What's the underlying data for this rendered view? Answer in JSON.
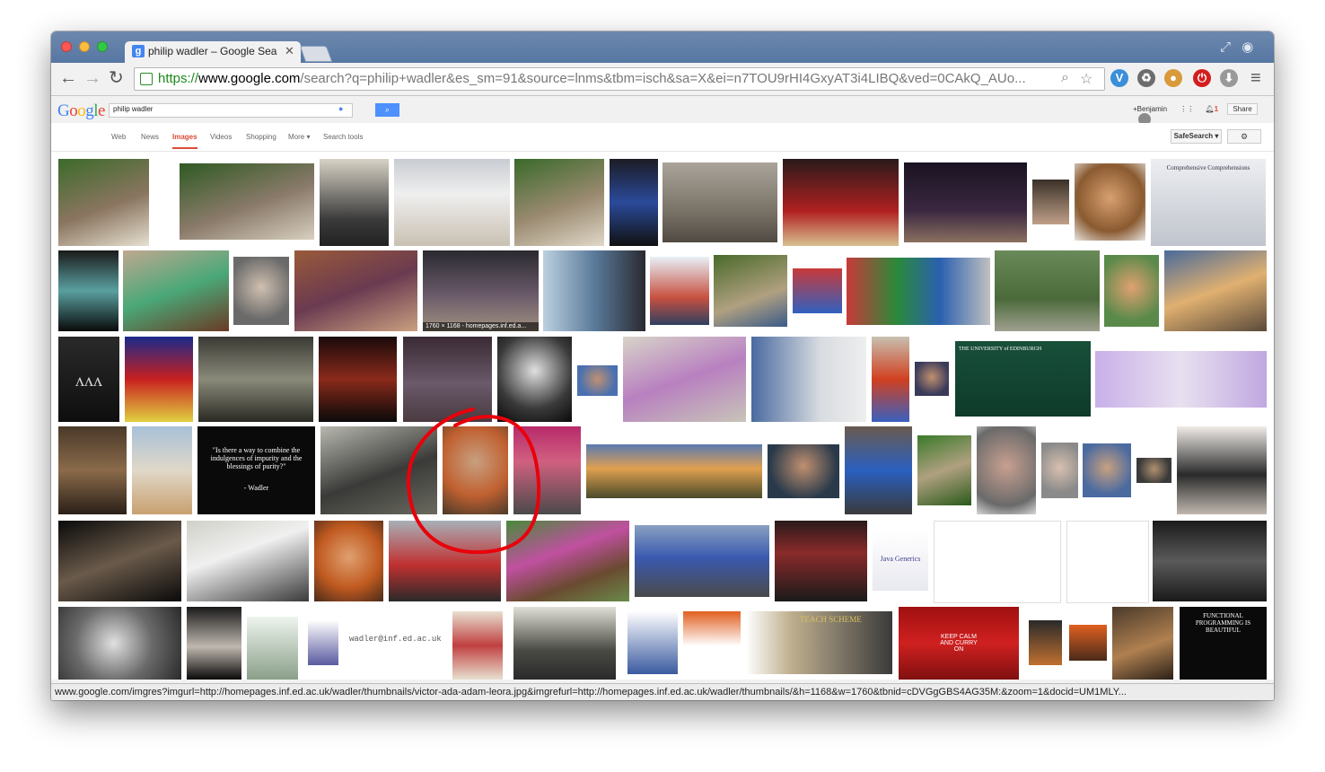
{
  "browser": {
    "tab_title": "philip wadler – Google Sea",
    "tab_favicon": "g",
    "url_scheme": "https://",
    "url_host": "www.google.com",
    "url_rest": "/search?q=philip+wadler&es_sm=91&source=lnms&tbm=isch&sa=X&ei=n7TOU9rHI4GxyAT3i4LIBQ&ved=0CAkQ_AUo...",
    "status_url": "www.google.com/imgres?imgurl=http://homepages.inf.ed.ac.uk/wadler/thumbnails/victor-ada-adam-leora.jpg&imgrefurl=http://homepages.inf.ed.ac.uk/wadler/thumbnails/&h=1168&w=1760&tbnid=cDVGgGBS4AG35M:&zoom=1&docid=UM1MLY..."
  },
  "google": {
    "logo": "Google",
    "query": "philip wadler",
    "user": "+Benjamin",
    "share": "Share",
    "notify_count": "1",
    "tabs": [
      "Web",
      "News",
      "Images",
      "Videos",
      "Shopping",
      "More",
      "Search tools"
    ],
    "safesearch": "SafeSearch"
  },
  "thumbs": {
    "homepage_overlay": "1760 × 1168 - homepages.inf.ed.a...",
    "quote": "\"Is there a way to combine the indulgences of impurity and the blessings of purity?\"",
    "quote_author": "- Wadler",
    "email": "wadler@inf.ed.ac.uk",
    "edinburgh": "THE UNIVERSITY of EDINBURGH",
    "teach_scheme": "TEACH SCHEME",
    "keep_calm": "KEEP CALM AND CURRY ON",
    "java_generics": "Java Generics",
    "comprehensive": "Comprehensive Comprehensions",
    "functional_programming": "FUNCTIONAL PROGRAMMING IS BEAUTIFUL"
  },
  "colors": {
    "annotation": "#e8000b",
    "search_button": "#4d90fe",
    "active_tab": "#dd4b39"
  }
}
